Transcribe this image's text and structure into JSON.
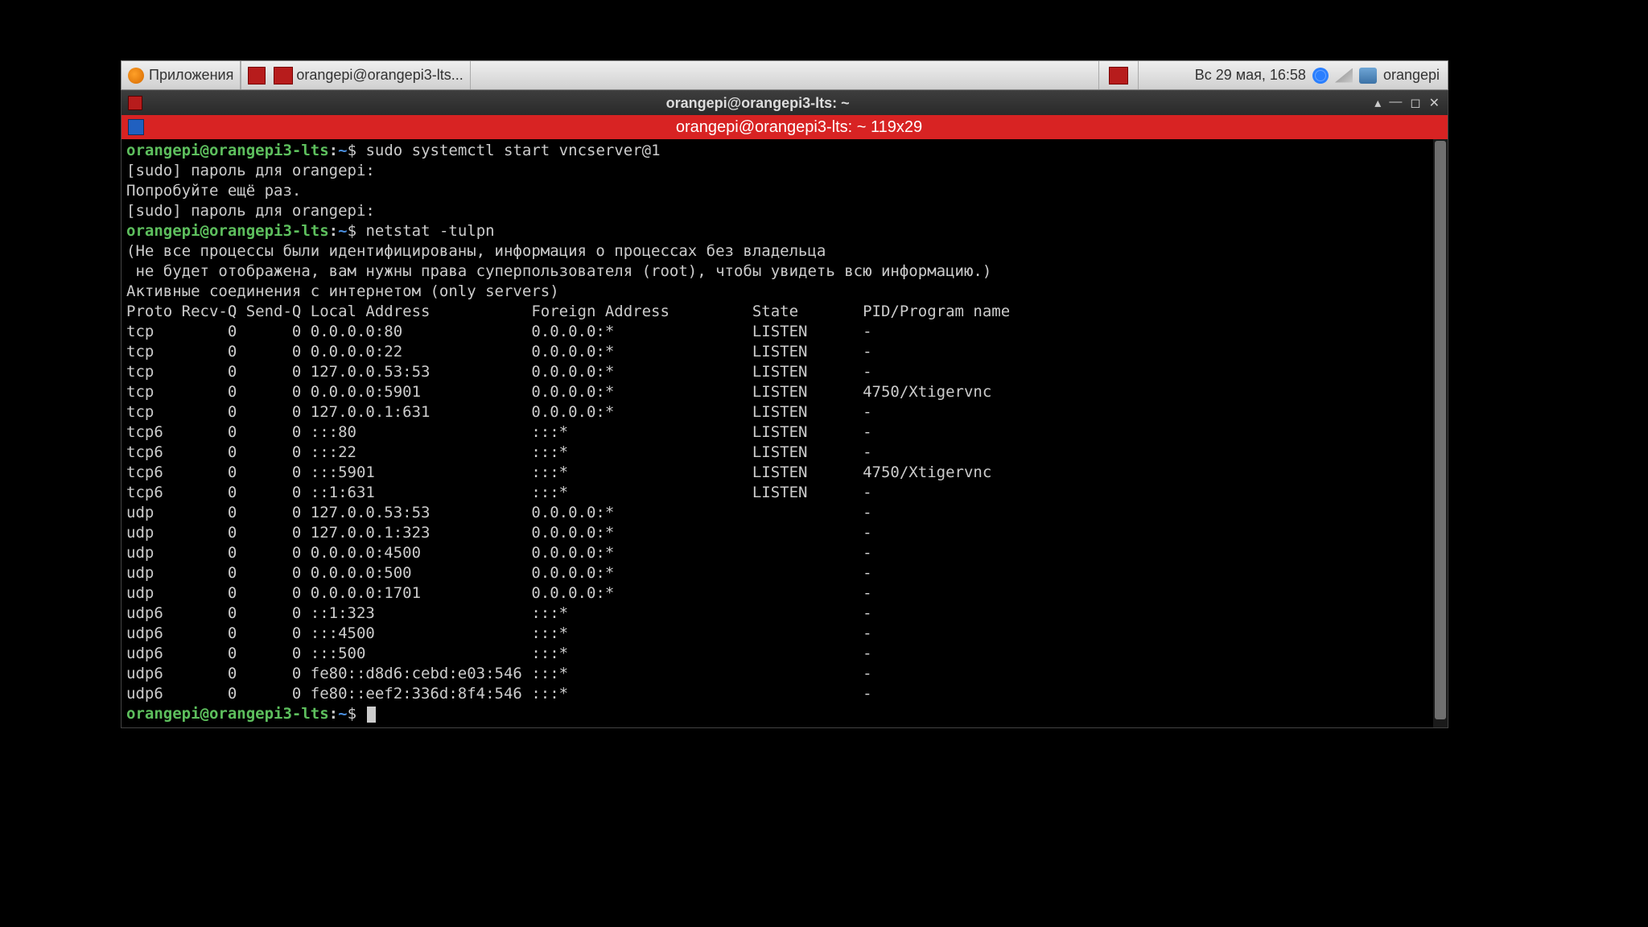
{
  "panel": {
    "apps_label": "Приложения",
    "taskbar_item": "orangepi@orangepi3-lts...",
    "clock": "Вс 29 мая, 16:58",
    "user": "orangepi"
  },
  "window": {
    "title": "orangepi@orangepi3-lts: ~",
    "tab_title": "orangepi@orangepi3-lts: ~ 119x29",
    "btn_up": "▴",
    "btn_min": "—",
    "btn_max": "◻",
    "btn_close": "✕"
  },
  "prompt": {
    "user_host": "orangepi@orangepi3-lts",
    "sep": ":",
    "path": "~",
    "dollar": "$"
  },
  "cmds": {
    "c1": "sudo systemctl start vncserver@1",
    "c2": "netstat -tulpn"
  },
  "lines": {
    "l1": "[sudo] пароль для orangepi: ",
    "l2": "Попробуйте ещё раз.",
    "l3": "[sudo] пароль для orangepi: ",
    "l4": "(Не все процессы были идентифицированы, информация о процессах без владельца",
    "l5": " не будет отображена, вам нужны права суперпользователя (root), чтобы увидеть всю информацию.)",
    "l6": "Активные соединения с интернетом (only servers)",
    "hdr": "Proto Recv-Q Send-Q Local Address Foreign Address State       PID/Program name"
  },
  "netstat": [
    {
      "proto": "tcp ",
      "rq": "0",
      "sq": "0",
      "local": "0.0.0.0:80     ",
      "foreign": "0.0.0.0:*",
      "state": "LISTEN ",
      "prog": "-"
    },
    {
      "proto": "tcp ",
      "rq": "0",
      "sq": "0",
      "local": "0.0.0.0:22     ",
      "foreign": "0.0.0.0:*",
      "state": "LISTEN ",
      "prog": "-"
    },
    {
      "proto": "tcp ",
      "rq": "0",
      "sq": "0",
      "local": "127.0.0.53:53  ",
      "foreign": "0.0.0.0:*",
      "state": "LISTEN ",
      "prog": "-"
    },
    {
      "proto": "tcp ",
      "rq": "0",
      "sq": "0",
      "local": "0.0.0.0:5901   ",
      "foreign": "0.0.0.0:*",
      "state": "LISTEN ",
      "prog": "4750/Xtigervnc"
    },
    {
      "proto": "tcp ",
      "rq": "0",
      "sq": "0",
      "local": "127.0.0.1:631  ",
      "foreign": "0.0.0.0:*",
      "state": "LISTEN ",
      "prog": "-"
    },
    {
      "proto": "tcp6",
      "rq": "0",
      "sq": "0",
      "local": ":::80          ",
      "foreign": ":::*     ",
      "state": "LISTEN ",
      "prog": "-"
    },
    {
      "proto": "tcp6",
      "rq": "0",
      "sq": "0",
      "local": ":::22          ",
      "foreign": ":::*     ",
      "state": "LISTEN ",
      "prog": "-"
    },
    {
      "proto": "tcp6",
      "rq": "0",
      "sq": "0",
      "local": ":::5901        ",
      "foreign": ":::*     ",
      "state": "LISTEN ",
      "prog": "4750/Xtigervnc"
    },
    {
      "proto": "tcp6",
      "rq": "0",
      "sq": "0",
      "local": "::1:631        ",
      "foreign": ":::*     ",
      "state": "LISTEN ",
      "prog": "-"
    },
    {
      "proto": "udp ",
      "rq": "0",
      "sq": "0",
      "local": "127.0.0.53:53  ",
      "foreign": "0.0.0.0:*",
      "state": "       ",
      "prog": "-"
    },
    {
      "proto": "udp ",
      "rq": "0",
      "sq": "0",
      "local": "127.0.0.1:323  ",
      "foreign": "0.0.0.0:*",
      "state": "       ",
      "prog": "-"
    },
    {
      "proto": "udp ",
      "rq": "0",
      "sq": "0",
      "local": "0.0.0.0:4500   ",
      "foreign": "0.0.0.0:*",
      "state": "       ",
      "prog": "-"
    },
    {
      "proto": "udp ",
      "rq": "0",
      "sq": "0",
      "local": "0.0.0.0:500    ",
      "foreign": "0.0.0.0:*",
      "state": "       ",
      "prog": "-"
    },
    {
      "proto": "udp ",
      "rq": "0",
      "sq": "0",
      "local": "0.0.0.0:1701   ",
      "foreign": "0.0.0.0:*",
      "state": "       ",
      "prog": "-"
    },
    {
      "proto": "udp6",
      "rq": "0",
      "sq": "0",
      "local": "::1:323        ",
      "foreign": ":::*     ",
      "state": "       ",
      "prog": "-"
    },
    {
      "proto": "udp6",
      "rq": "0",
      "sq": "0",
      "local": ":::4500        ",
      "foreign": ":::*     ",
      "state": "       ",
      "prog": "-"
    },
    {
      "proto": "udp6",
      "rq": "0",
      "sq": "0",
      "local": ":::500         ",
      "foreign": ":::*     ",
      "state": "       ",
      "prog": "-"
    },
    {
      "proto": "udp6",
      "rq": "0",
      "sq": "0",
      "local": "fe80::d8d6:cebd:e03:546",
      "foreign": ":::*",
      "state": "   ",
      "prog": "-"
    },
    {
      "proto": "udp6",
      "rq": "0",
      "sq": "0",
      "local": "fe80::eef2:336d:8f4:546",
      "foreign": ":::*",
      "state": "   ",
      "prog": "-"
    }
  ]
}
